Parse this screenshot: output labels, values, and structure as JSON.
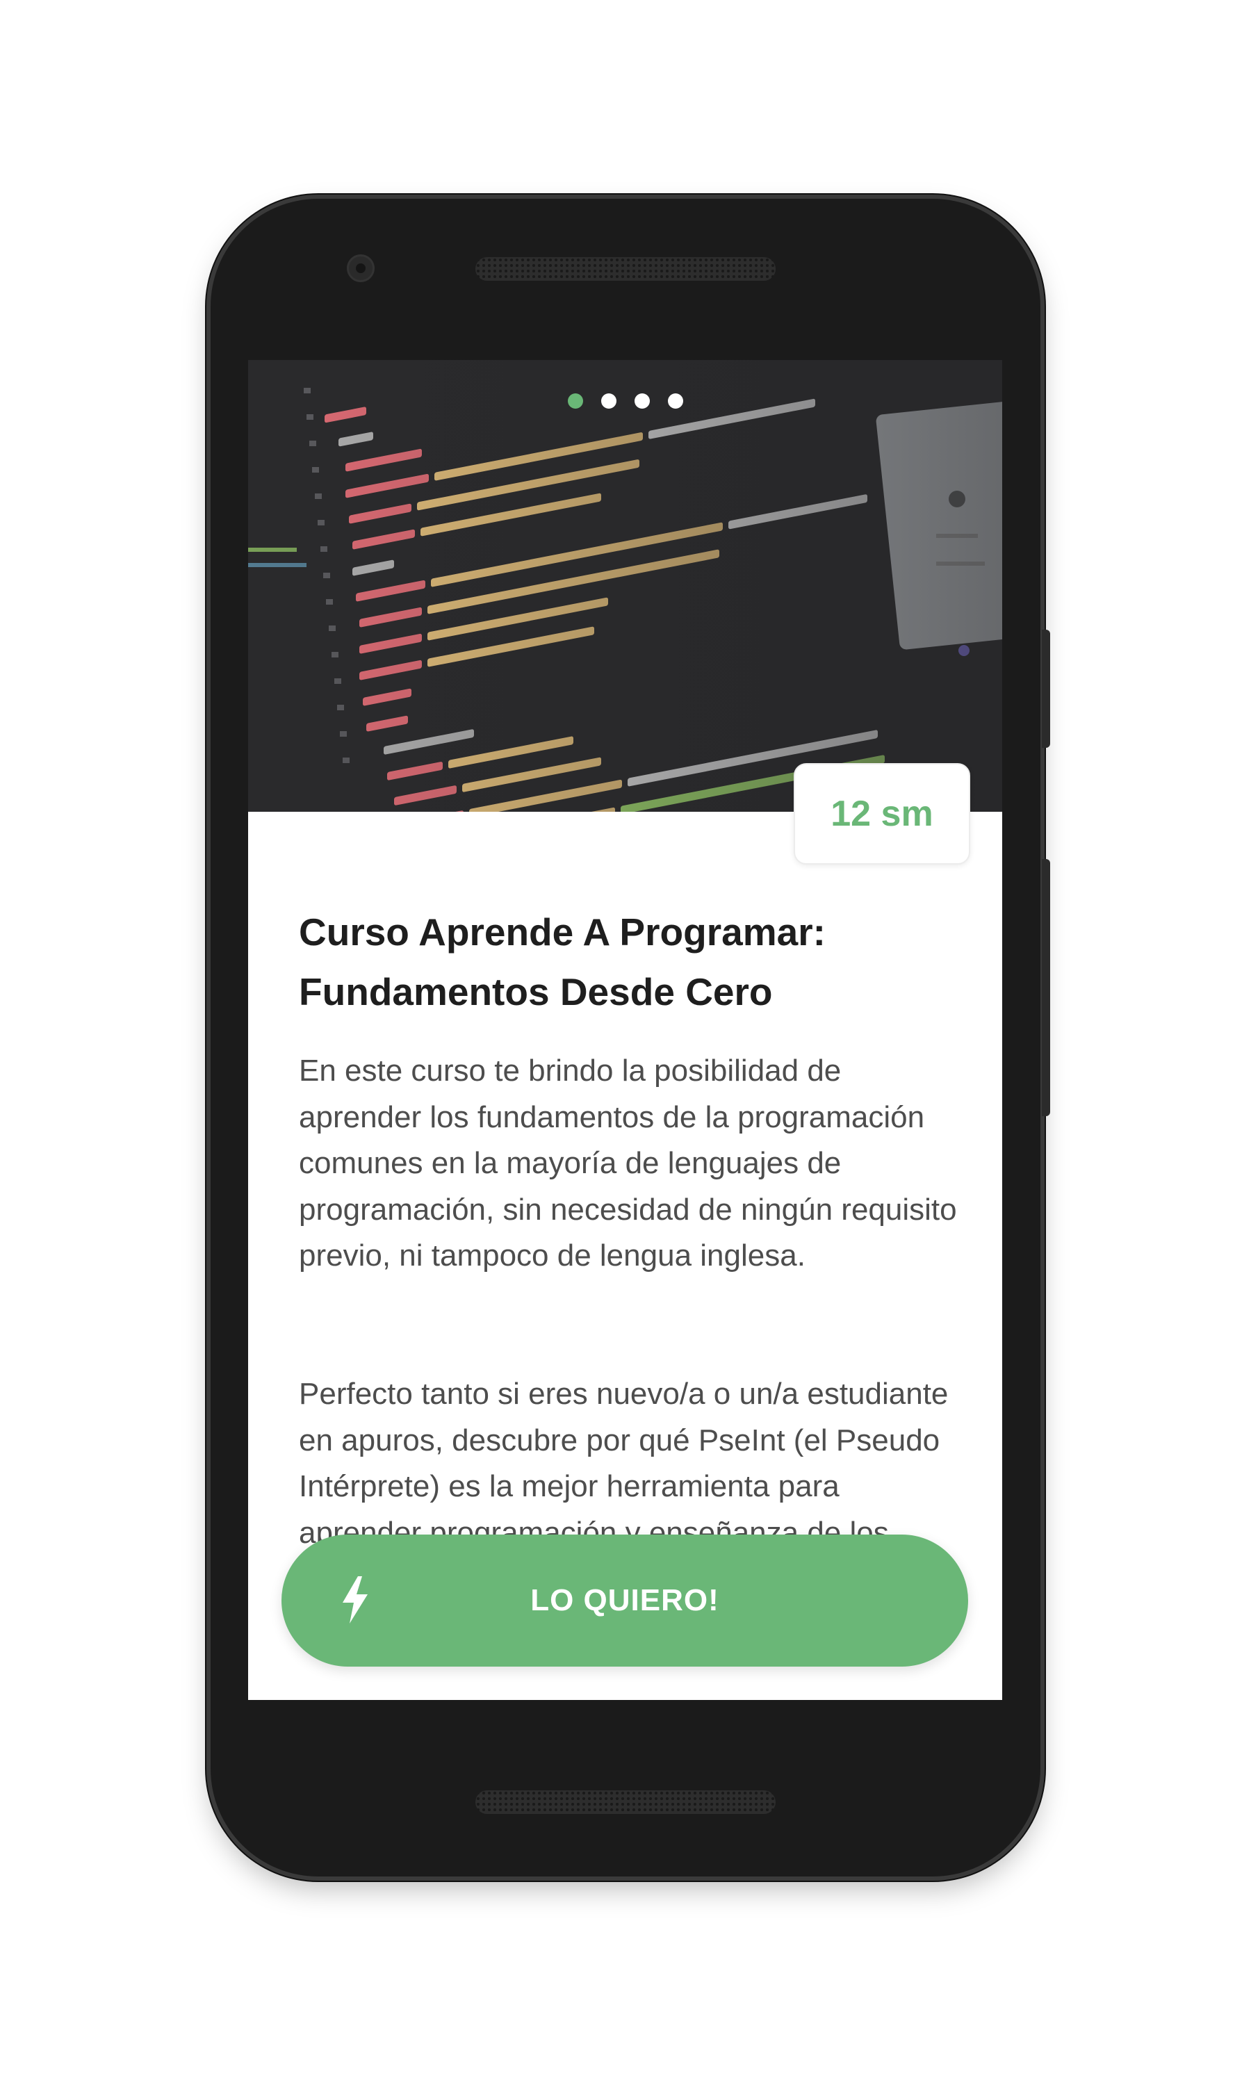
{
  "carousel": {
    "slides": 4,
    "active_index": 0,
    "active_color": "#6ab777"
  },
  "course": {
    "duration": "12 sm",
    "title": "Curso Aprende A Programar: Fundamentos Desde Cero",
    "description": [
      "En este curso te brindo la posibilidad de aprender los fundamentos de la programación comunes en la mayoría de lenguajes de programación, sin necesidad de ningún requisito previo, ni tampoco de lengua inglesa.",
      "Perfecto tanto si eres nuevo/a o un/a estudiante en apuros, descubre por qué PseInt (el Pseudo Intérprete) es la mejor herramienta para aprender programación y enseñanza de los futuros programadores/"
    ]
  },
  "cta": {
    "label": "LO QUIERO!",
    "icon": "lightning-bolt-icon",
    "color": "#6ab777"
  },
  "device": {
    "icons": [
      "front-camera-icon",
      "earpiece-speaker-icon",
      "bottom-speaker-icon"
    ]
  }
}
